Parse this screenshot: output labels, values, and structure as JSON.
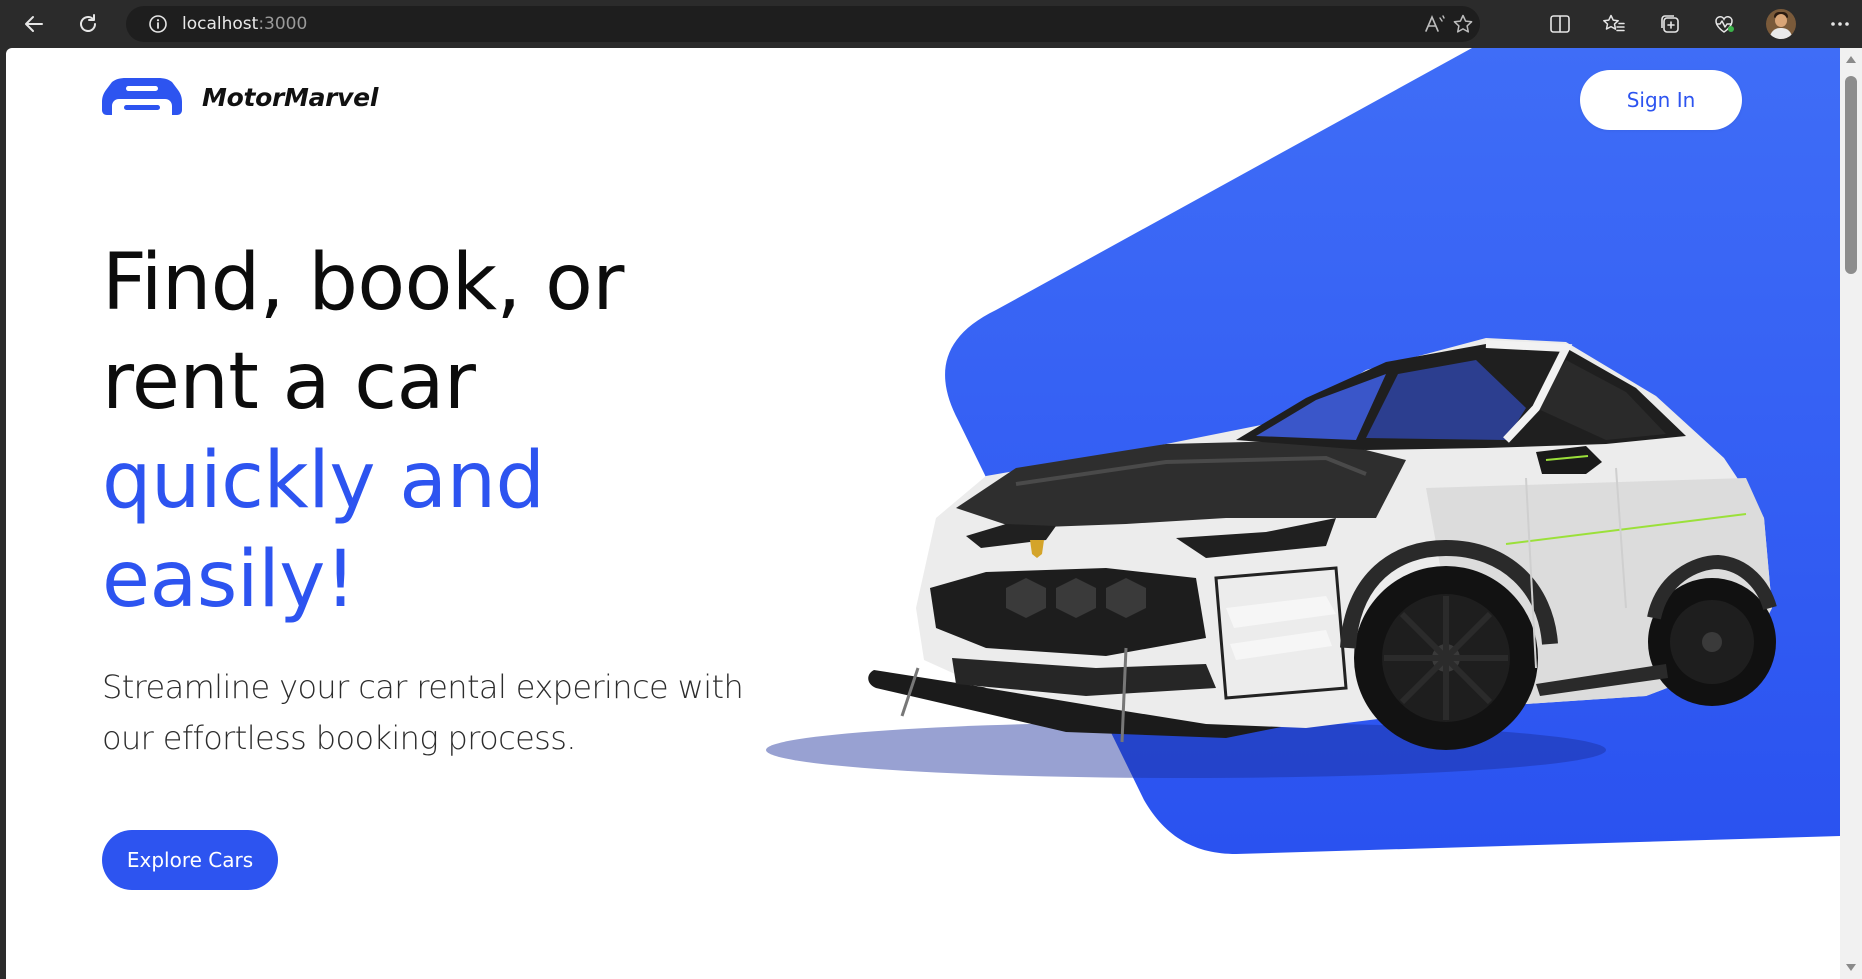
{
  "browser": {
    "url_host": "localhost",
    "url_port": ":3000"
  },
  "brand": {
    "name": "MotorMarvel"
  },
  "nav": {
    "signin_label": "Sign In"
  },
  "hero": {
    "headline_line1": "Find, book, or",
    "headline_line2": "rent a car",
    "headline_accent_line1": "quickly and",
    "headline_accent_line2": "easily!",
    "subtitle_line1": "Streamline your car rental experince with",
    "subtitle_line2": "our effortless booking process.",
    "cta_label": "Explore Cars"
  },
  "colors": {
    "accent": "#2d54f0",
    "text": "#0c0c0c",
    "chrome": "#2b2b2b"
  },
  "icons": {
    "back": "arrow-left-icon",
    "reload": "reload-icon",
    "site_info": "info-icon",
    "read_aloud": "read-aloud-icon",
    "favorite": "star-icon",
    "split_screen": "split-screen-icon",
    "favorites": "favorites-icon",
    "collections": "collections-icon",
    "performance": "heartbeat-icon",
    "more": "more-icon",
    "logo": "car-logo-icon"
  }
}
